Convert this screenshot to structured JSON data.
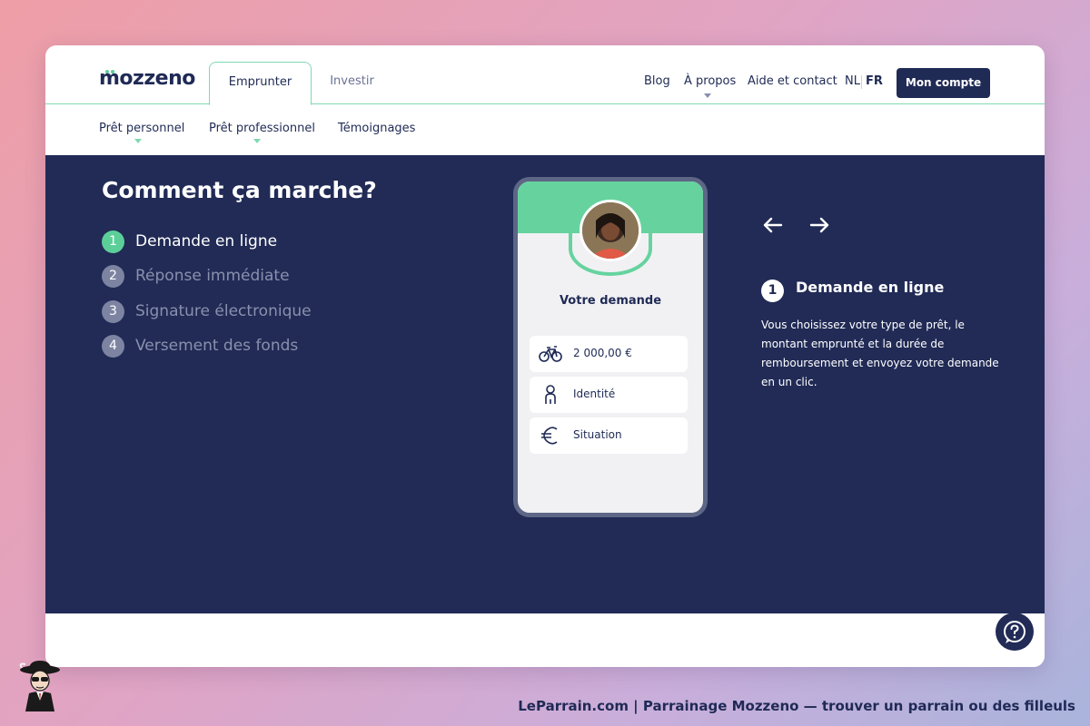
{
  "header": {
    "logo": "mozzeno",
    "tabs": [
      {
        "label": "Emprunter",
        "active": true
      },
      {
        "label": "Investir",
        "active": false
      }
    ],
    "nav": {
      "blog": "Blog",
      "about": "À propos",
      "help_contact": "Aide et contact"
    },
    "languages": [
      "NL",
      "FR"
    ],
    "active_language": "FR",
    "account_button": "Mon compte"
  },
  "subnav": {
    "items": [
      "Prêt personnel",
      "Prêt professionnel",
      "Témoignages"
    ]
  },
  "hero": {
    "title": "Comment ça marche?",
    "steps": [
      {
        "num": "1",
        "label": "Demande en ligne",
        "active": true
      },
      {
        "num": "2",
        "label": "Réponse immédiate",
        "active": false
      },
      {
        "num": "3",
        "label": "Signature électronique",
        "active": false
      },
      {
        "num": "4",
        "label": "Versement des fonds",
        "active": false
      }
    ],
    "phone": {
      "title": "Votre demande",
      "rows": [
        {
          "icon": "bicycle-icon",
          "label": "2 000,00 €"
        },
        {
          "icon": "person-icon",
          "label": "Identité"
        },
        {
          "icon": "euro-icon",
          "label": "Situation"
        }
      ]
    },
    "detail": {
      "num": "1",
      "title": "Demande en ligne",
      "text": "Vous choisissez votre type de prêt, le montant emprunté et la durée de remboursement et envoyez votre demande en un clic."
    }
  },
  "footer": {
    "caption": "LeParrain.com | Parrainage Mozzeno — trouver un parrain ou des filleuls"
  },
  "colors": {
    "navy": "#212b56",
    "brand_text": "#1f2a55",
    "mint": "#66d39f",
    "tab_border": "#7fd9b2"
  }
}
